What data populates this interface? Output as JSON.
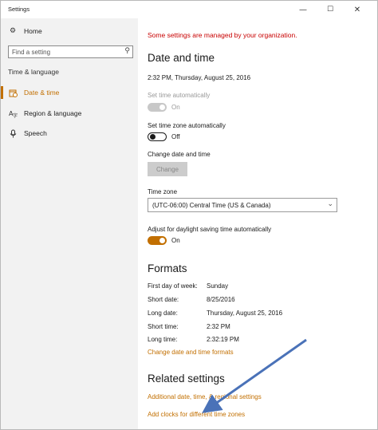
{
  "window": {
    "title": "Settings",
    "minimize": "—",
    "maximize": "☐",
    "close": "✕"
  },
  "sidebar": {
    "home_label": "Home",
    "search_placeholder": "Find a setting",
    "group_label": "Time & language",
    "items": [
      {
        "label": "Date & time",
        "icon": "calendar-clock-icon",
        "active": true
      },
      {
        "label": "Region & language",
        "icon": "globe-language-icon",
        "active": false
      },
      {
        "label": "Speech",
        "icon": "microphone-icon",
        "active": false
      }
    ]
  },
  "main": {
    "warning": "Some settings are managed by your organization.",
    "date_time_heading": "Date and time",
    "current_datetime": "2:32 PM, Thursday, August 25, 2016",
    "set_time_auto_label": "Set time automatically",
    "set_time_auto_state": "On",
    "set_tz_auto_label": "Set time zone automatically",
    "set_tz_auto_state": "Off",
    "change_dt_label": "Change date and time",
    "change_button": "Change",
    "time_zone_label": "Time zone",
    "time_zone_value": "(UTC-06:00) Central Time (US & Canada)",
    "dst_label": "Adjust for daylight saving time automatically",
    "dst_state": "On",
    "formats_heading": "Formats",
    "formats": [
      {
        "key": "First day of week:",
        "value": "Sunday"
      },
      {
        "key": "Short date:",
        "value": "8/25/2016"
      },
      {
        "key": "Long date:",
        "value": "Thursday, August 25, 2016"
      },
      {
        "key": "Short time:",
        "value": "2:32 PM"
      },
      {
        "key": "Long time:",
        "value": "2:32:19 PM"
      }
    ],
    "change_formats_link": "Change date and time formats",
    "related_heading": "Related settings",
    "related_link_1": "Additional date, time, & regional settings",
    "related_link_2": "Add clocks for different time zones"
  },
  "colors": {
    "accent": "#c26f00",
    "warning": "#c80000",
    "annotation_arrow": "#4a72b8"
  }
}
